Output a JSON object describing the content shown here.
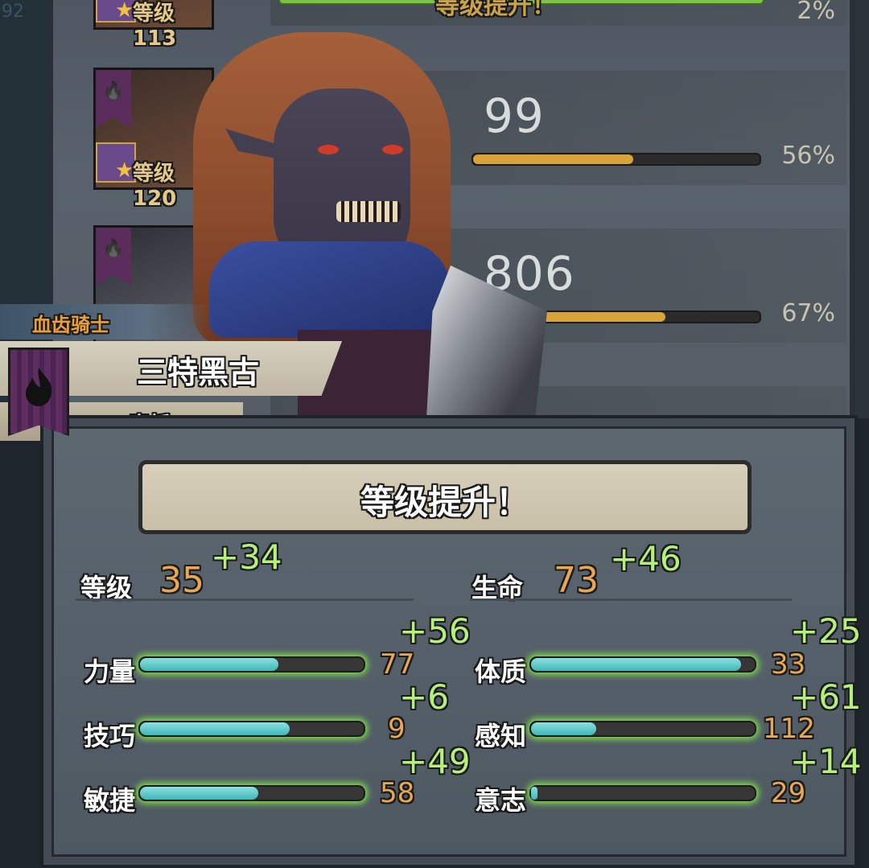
{
  "side_number": "92",
  "list": {
    "rows": [
      {
        "level_label": "等级113",
        "number": "",
        "percent": "2%",
        "progress": 0.02,
        "top_text": "等级提升！"
      },
      {
        "level_label": "等级120",
        "number": "99",
        "percent": "56%",
        "progress": 0.56
      },
      {
        "level_label": "",
        "number": "806",
        "percent": "67%",
        "progress": 0.67
      }
    ]
  },
  "character": {
    "class_name": "血齿骑士",
    "name": "三特黑古",
    "house": "青栀"
  },
  "panel": {
    "title": "等级提升！",
    "level": {
      "label": "等级",
      "value": "35",
      "gain": "+34"
    },
    "health": {
      "label": "生命",
      "value": "73",
      "gain": "+46"
    },
    "stats_left": [
      {
        "label": "力量",
        "value": "77",
        "gain": "+56",
        "fill": 0.62
      },
      {
        "label": "技巧",
        "value": "9",
        "gain": "+6",
        "fill": 0.67
      },
      {
        "label": "敏捷",
        "value": "58",
        "gain": "+49",
        "fill": 0.53
      }
    ],
    "stats_right": [
      {
        "label": "体质",
        "value": "33",
        "gain": "+25",
        "fill": 0.94
      },
      {
        "label": "感知",
        "value": "112",
        "gain": "+61",
        "fill": 0.29
      },
      {
        "label": "意志",
        "value": "29",
        "gain": "+14",
        "fill": 0.02
      }
    ]
  },
  "colors": {
    "stat_value": "#e7a755",
    "gain": "#b6f07c",
    "bar_fill": "#3fb7b6",
    "bar_glow": "#7fe04a",
    "class_tag": "#e8a03c"
  }
}
